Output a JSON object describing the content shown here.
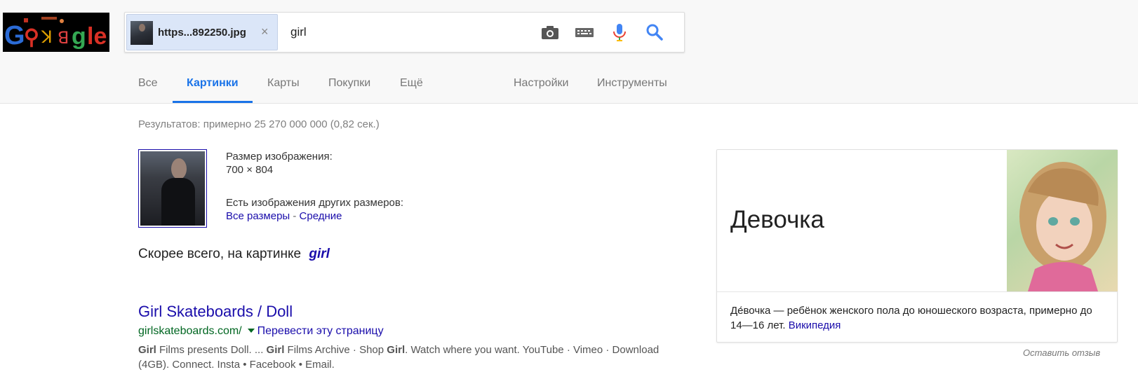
{
  "logo": {
    "alt_text": "Google"
  },
  "search": {
    "image_chip_name": "https...892250.jpg",
    "chip_close": "×",
    "query": "girl",
    "icons": [
      "camera-icon",
      "keyboard-icon",
      "microphone-icon",
      "search-icon"
    ]
  },
  "nav": {
    "tabs": [
      {
        "label": "Все",
        "active": false
      },
      {
        "label": "Картинки",
        "active": true
      },
      {
        "label": "Карты",
        "active": false
      },
      {
        "label": "Покупки",
        "active": false
      },
      {
        "label": "Ещё",
        "active": false
      }
    ],
    "settings": "Настройки",
    "tools": "Инструменты"
  },
  "results": {
    "stats": "Результатов: примерно 25 270 000 000 (0,82 сек.)",
    "image_size_label": "Размер изображения:",
    "image_size_value": "700 × 804",
    "other_sizes_label": "Есть изображения других размеров:",
    "all_sizes_link": "Все размеры",
    "sizes_separator": "-",
    "medium_link": "Средние",
    "best_guess_label": "Скорее всего, на картинке",
    "best_guess_query": "girl"
  },
  "result_item": {
    "title": "Girl Skateboards / Doll",
    "url": "girlskateboards.com/",
    "translate": "Перевести эту страницу",
    "snippet_parts": [
      {
        "text": "Girl",
        "bold": true
      },
      {
        "text": " Films presents Doll. ... ",
        "bold": false
      },
      {
        "text": "Girl",
        "bold": true
      },
      {
        "text": " Films Archive · Shop ",
        "bold": false
      },
      {
        "text": "Girl",
        "bold": true
      },
      {
        "text": ". Watch where you want. YouTube · Vimeo · Download (4GB). Connect. Insta • Facebook • Email.",
        "bold": false
      }
    ]
  },
  "knowledge_panel": {
    "title": "Девочка",
    "description": "Де́вочка — ребёнок женского пола до юношеского возраста, примерно до 14—16 лет.",
    "source_link": "Википедия",
    "feedback": "Оставить отзыв"
  },
  "colors": {
    "link": "#1a0dab",
    "active_tab": "#1a73e8",
    "url_green": "#006621",
    "muted": "#808080"
  }
}
